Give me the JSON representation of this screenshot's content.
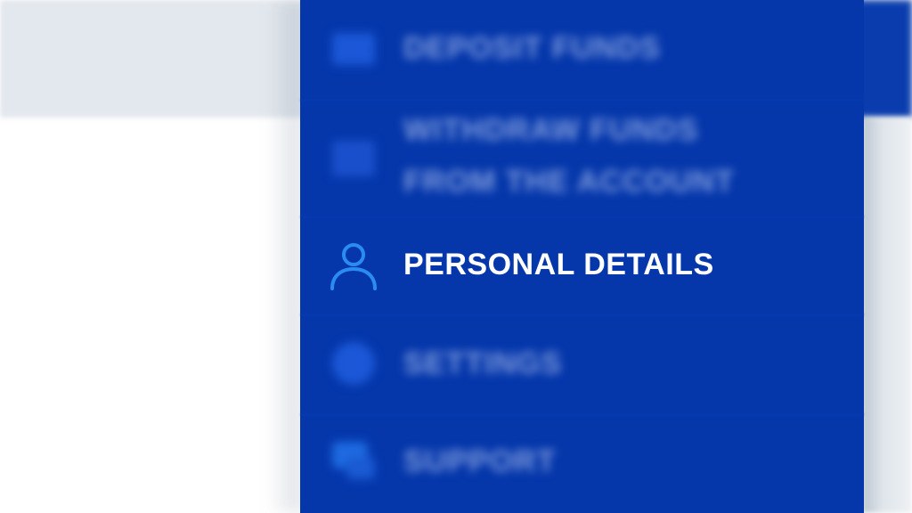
{
  "menu": {
    "items": [
      {
        "label": "DEPOSIT FUNDS",
        "icon": "deposit-icon",
        "state": "blurred"
      },
      {
        "label_line1": "WITHDRAW FUNDS",
        "label_line2": "FROM THE ACCOUNT",
        "icon": "withdraw-icon",
        "state": "blurred"
      },
      {
        "label": "PERSONAL DETAILS",
        "icon": "user-icon",
        "state": "focused"
      },
      {
        "label": "SETTINGS",
        "icon": "settings-icon",
        "state": "blurred"
      },
      {
        "label": "SUPPORT",
        "icon": "chat-icon",
        "state": "blurred"
      }
    ]
  },
  "colors": {
    "menu_bg": "#0537ab",
    "icon_accent": "#2a8cf0",
    "text": "#ffffff",
    "page_bg": "#ffffff",
    "header_bg": "#e3e8ee"
  }
}
